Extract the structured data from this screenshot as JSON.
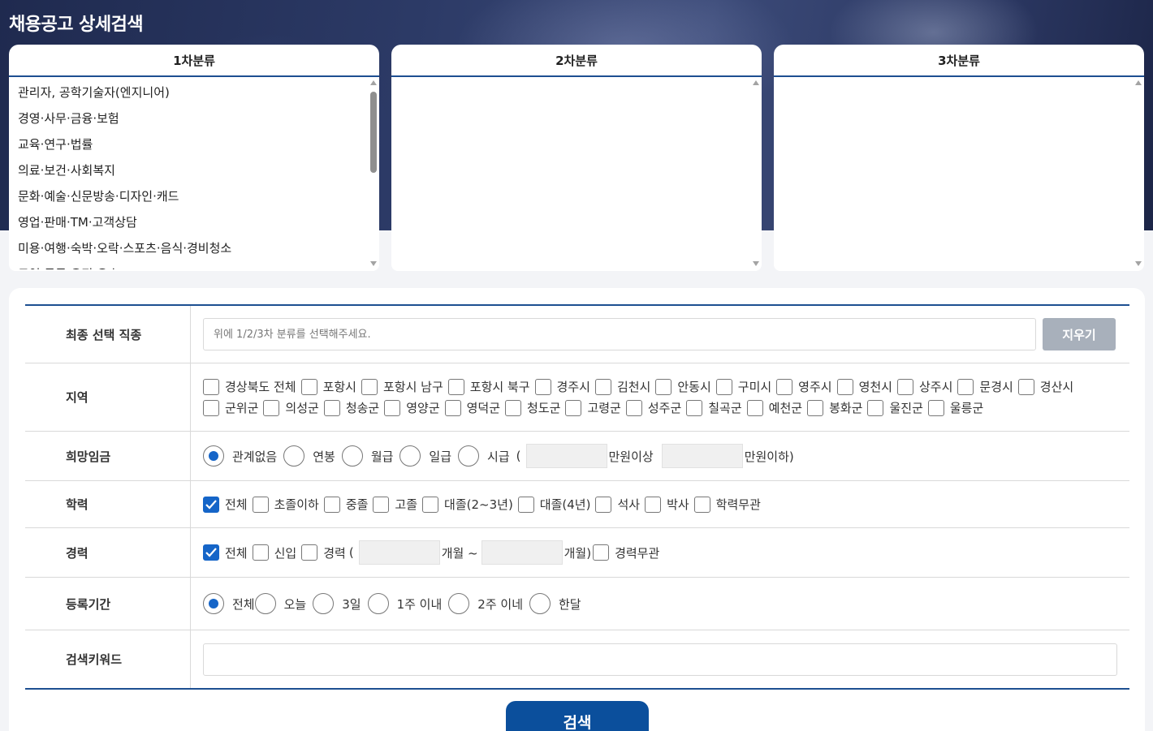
{
  "page_title": "채용공고 상세검색",
  "categories": {
    "first": {
      "heading": "1차분류",
      "items": [
        "관리자, 공학기술자(엔지니어)",
        "경영·사무·금융·보험",
        "교육·연구·법률",
        "의료·보건·사회복지",
        "문화·예술·신문방송·디자인·캐드",
        "영업·판매·TM·고객상담",
        "미용·여행·숙박·오락·스포츠·음식·경비청소",
        "무역·물류·운전·운송"
      ]
    },
    "second": {
      "heading": "2차분류"
    },
    "third": {
      "heading": "3차분류"
    }
  },
  "form": {
    "final_job": {
      "label": "최종 선택 직종",
      "placeholder": "위에 1/2/3차 분류를 선택해주세요.",
      "clear_label": "지우기"
    },
    "region": {
      "label": "지역",
      "options": [
        {
          "label": "경상북도 전체",
          "checked": false
        },
        {
          "label": "포항시",
          "checked": false
        },
        {
          "label": "포항시 남구",
          "checked": false
        },
        {
          "label": "포항시 북구",
          "checked": false
        },
        {
          "label": "경주시",
          "checked": false
        },
        {
          "label": "김천시",
          "checked": false
        },
        {
          "label": "안동시",
          "checked": false
        },
        {
          "label": "구미시",
          "checked": false
        },
        {
          "label": "영주시",
          "checked": false
        },
        {
          "label": "영천시",
          "checked": false
        },
        {
          "label": "상주시",
          "checked": false
        },
        {
          "label": "문경시",
          "checked": false
        },
        {
          "label": "경산시",
          "checked": false
        },
        {
          "label": "군위군",
          "checked": false
        },
        {
          "label": "의성군",
          "checked": false
        },
        {
          "label": "청송군",
          "checked": false
        },
        {
          "label": "영양군",
          "checked": false
        },
        {
          "label": "영덕군",
          "checked": false
        },
        {
          "label": "청도군",
          "checked": false
        },
        {
          "label": "고령군",
          "checked": false
        },
        {
          "label": "성주군",
          "checked": false
        },
        {
          "label": "칠곡군",
          "checked": false
        },
        {
          "label": "예천군",
          "checked": false
        },
        {
          "label": "봉화군",
          "checked": false
        },
        {
          "label": "울진군",
          "checked": false
        },
        {
          "label": "울릉군",
          "checked": false
        }
      ]
    },
    "salary": {
      "label": "희망임금",
      "options": [
        {
          "label": "관계없음",
          "selected": true
        },
        {
          "label": "연봉",
          "selected": false
        },
        {
          "label": "월급",
          "selected": false
        },
        {
          "label": "일급",
          "selected": false
        },
        {
          "label": "시급",
          "selected": false
        }
      ],
      "open_paren": "(",
      "min_suffix": "만원이상",
      "max_suffix": "만원이하)"
    },
    "education": {
      "label": "학력",
      "options": [
        {
          "label": "전체",
          "checked": true
        },
        {
          "label": "초졸이하",
          "checked": false
        },
        {
          "label": "중졸",
          "checked": false
        },
        {
          "label": "고졸",
          "checked": false
        },
        {
          "label": "대졸(2~3년)",
          "checked": false
        },
        {
          "label": "대졸(4년)",
          "checked": false
        },
        {
          "label": "석사",
          "checked": false
        },
        {
          "label": "박사",
          "checked": false
        },
        {
          "label": "학력무관",
          "checked": false
        }
      ]
    },
    "career": {
      "label": "경력",
      "all": "전체",
      "new": "신입",
      "experienced": "경력",
      "open_paren": "(",
      "months_tilde": "개월 ~",
      "months_close": "개월)",
      "irrelevant": "경력무관"
    },
    "period": {
      "label": "등록기간",
      "options": [
        {
          "label": "전체",
          "selected": true
        },
        {
          "label": "오늘",
          "selected": false
        },
        {
          "label": "3일",
          "selected": false
        },
        {
          "label": "1주 이내",
          "selected": false
        },
        {
          "label": "2주 이네",
          "selected": false
        },
        {
          "label": "한달",
          "selected": false
        }
      ]
    },
    "keyword": {
      "label": "검색키워드"
    }
  },
  "search_label": "검색",
  "colors": {
    "accent": "#1d4f91",
    "check": "#1565c8",
    "search_button": "#0b4f9c",
    "clear_button": "#a8b0bb"
  }
}
